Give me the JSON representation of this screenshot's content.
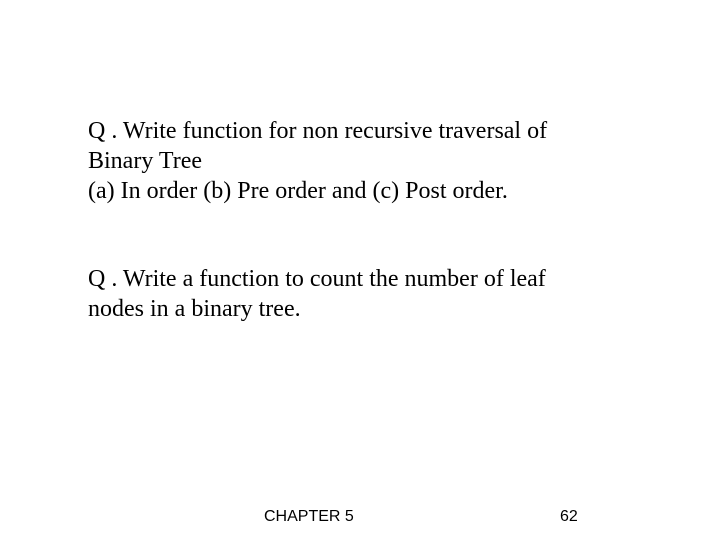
{
  "question1": {
    "line1": "Q . Write function for non recursive traversal of",
    "line2": "Binary Tree",
    "line3": "(a) In order (b) Pre order and (c) Post order."
  },
  "question2": {
    "line1": "Q . Write a function to count the number of leaf",
    "line2": "nodes in a binary tree."
  },
  "footer": {
    "chapter": "CHAPTER 5",
    "page": "62"
  }
}
